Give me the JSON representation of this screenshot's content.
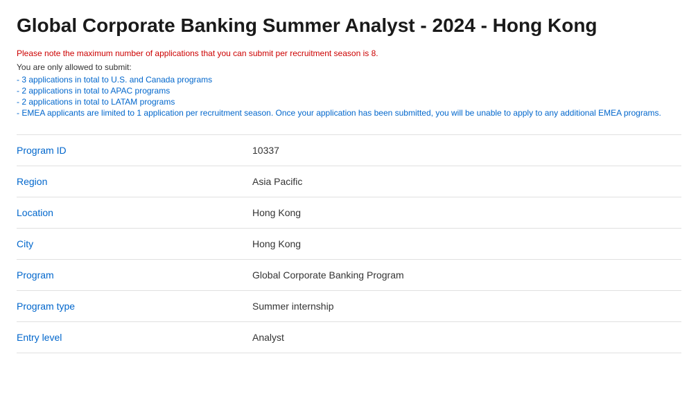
{
  "page": {
    "title": "Global Corporate Banking Summer Analyst - 2024 - Hong Kong",
    "warning": "Please note the maximum number of applications that you can submit per recruitment season is 8.",
    "intro": "You are only allowed to submit:",
    "rules": [
      "- 3 applications in total to U.S. and Canada programs",
      "- 2 applications in total to APAC programs",
      "- 2 applications in total to LATAM programs",
      "- EMEA applicants are limited to 1 application per recruitment season. Once your application has been submitted, you will be unable to apply to any additional EMEA programs."
    ],
    "fields": [
      {
        "label": "Program ID",
        "value": "10337"
      },
      {
        "label": "Region",
        "value": "Asia Pacific"
      },
      {
        "label": "Location",
        "value": "Hong Kong"
      },
      {
        "label": "City",
        "value": "Hong Kong"
      },
      {
        "label": "Program",
        "value": "Global Corporate Banking Program"
      },
      {
        "label": "Program type",
        "value": "Summer internship"
      },
      {
        "label": "Entry level",
        "value": "Analyst"
      }
    ]
  }
}
